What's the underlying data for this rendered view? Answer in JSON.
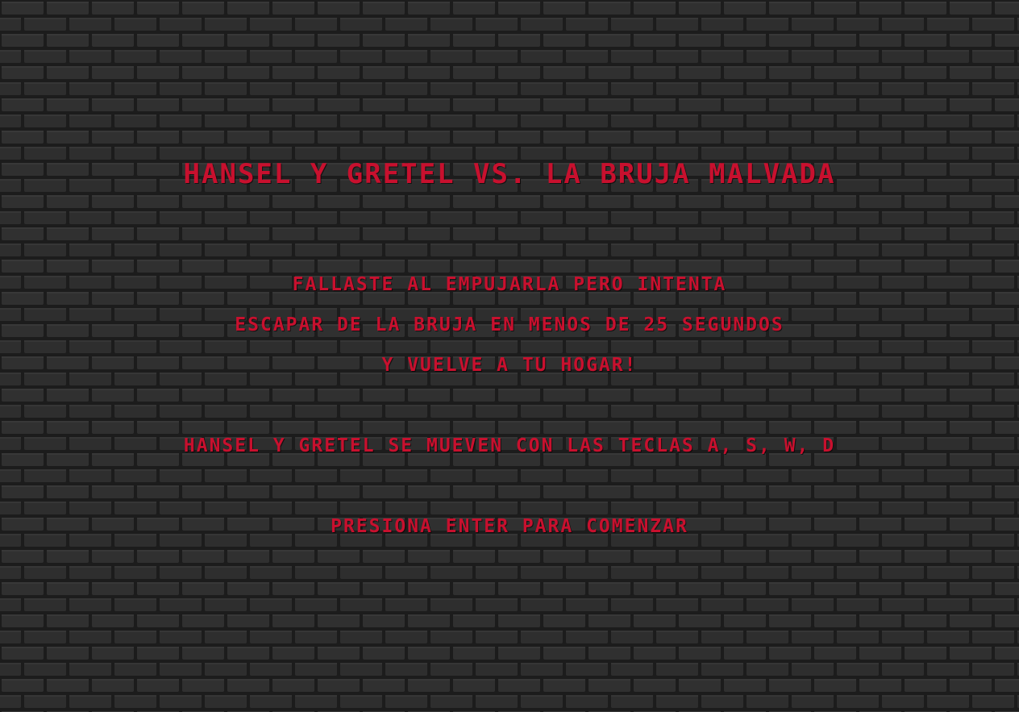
{
  "colors": {
    "text": "#c8102e",
    "background": "#262626",
    "brick": "#303030",
    "mortar": "#1c1c1c"
  },
  "background": {
    "icon": "brick-wall-texture"
  },
  "screen": {
    "title": "Hansel y Gretel vs. La Bruja Malvada",
    "message_lines": [
      "Fallaste al empujarla pero intenta",
      "escapar de la bruja en menos de 25 segundos",
      "y vuelve a tu hogar!"
    ],
    "controls": "Hansel y Gretel se mueven con las teclas A, S, W, D",
    "start_prompt": "Presiona ENTER para comenzar"
  }
}
